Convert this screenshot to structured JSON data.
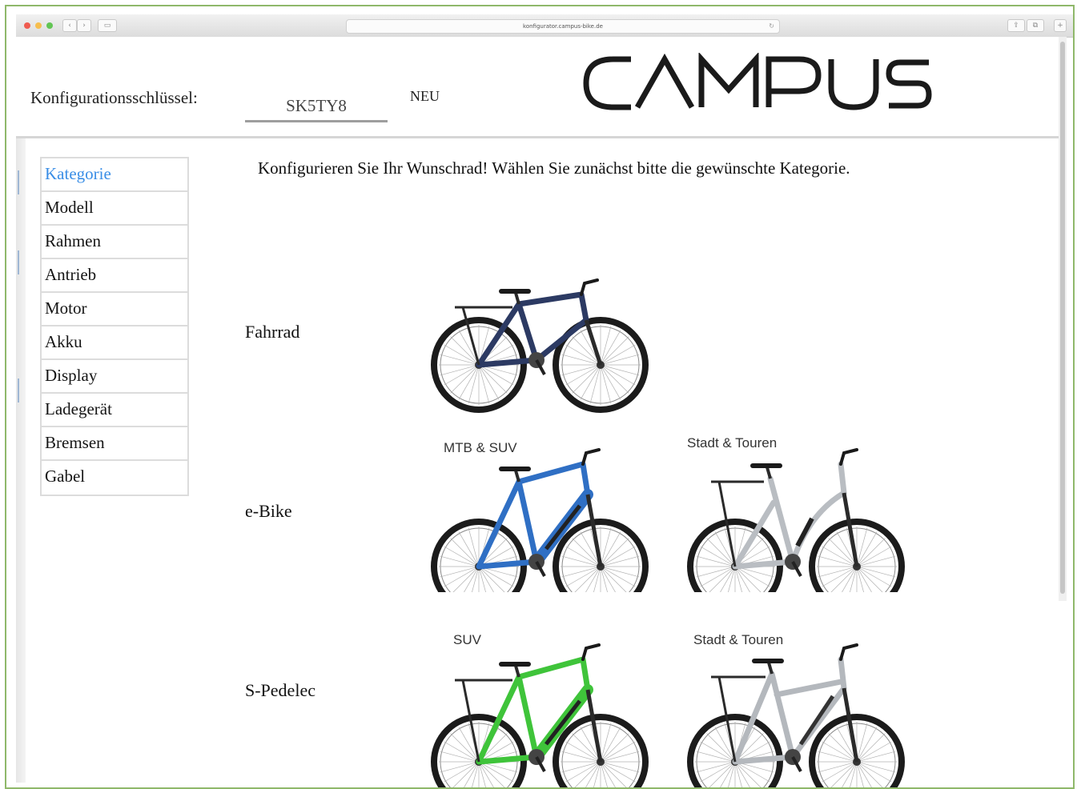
{
  "browser": {
    "url": "konfigurator.campus-bike.de"
  },
  "header": {
    "config_label": "Konfigurationsschlüssel:",
    "config_key": "SK5TY8",
    "new_button": "NEU",
    "logo_text": "CAMPUS"
  },
  "sidebar": {
    "items": [
      {
        "label": "Kategorie",
        "active": true
      },
      {
        "label": "Modell"
      },
      {
        "label": "Rahmen"
      },
      {
        "label": "Antrieb"
      },
      {
        "label": "Motor"
      },
      {
        "label": "Akku"
      },
      {
        "label": "Display"
      },
      {
        "label": "Ladegerät"
      },
      {
        "label": "Bremsen"
      },
      {
        "label": "Gabel"
      }
    ]
  },
  "main": {
    "intro": "Konfigurieren Sie Ihr Wunschrad! Wählen Sie zunächst bitte die gewünschte Kategorie.",
    "categories": [
      {
        "label": "Fahrrad",
        "bikes": [
          {
            "caption": "",
            "color": "#2c3a63"
          }
        ]
      },
      {
        "label": "e-Bike",
        "bikes": [
          {
            "caption": "MTB & SUV",
            "color": "#2f6fc4"
          },
          {
            "caption": "Stadt & Touren",
            "color": "#b9bdc2"
          }
        ]
      },
      {
        "label": "S-Pedelec",
        "bikes": [
          {
            "caption": "SUV",
            "color": "#3fc43a"
          },
          {
            "caption": "Stadt & Touren",
            "color": "#b4b8bd"
          }
        ]
      }
    ]
  },
  "colors": {
    "accent": "#3a8ee6",
    "frame_border": "#8fb86a"
  }
}
